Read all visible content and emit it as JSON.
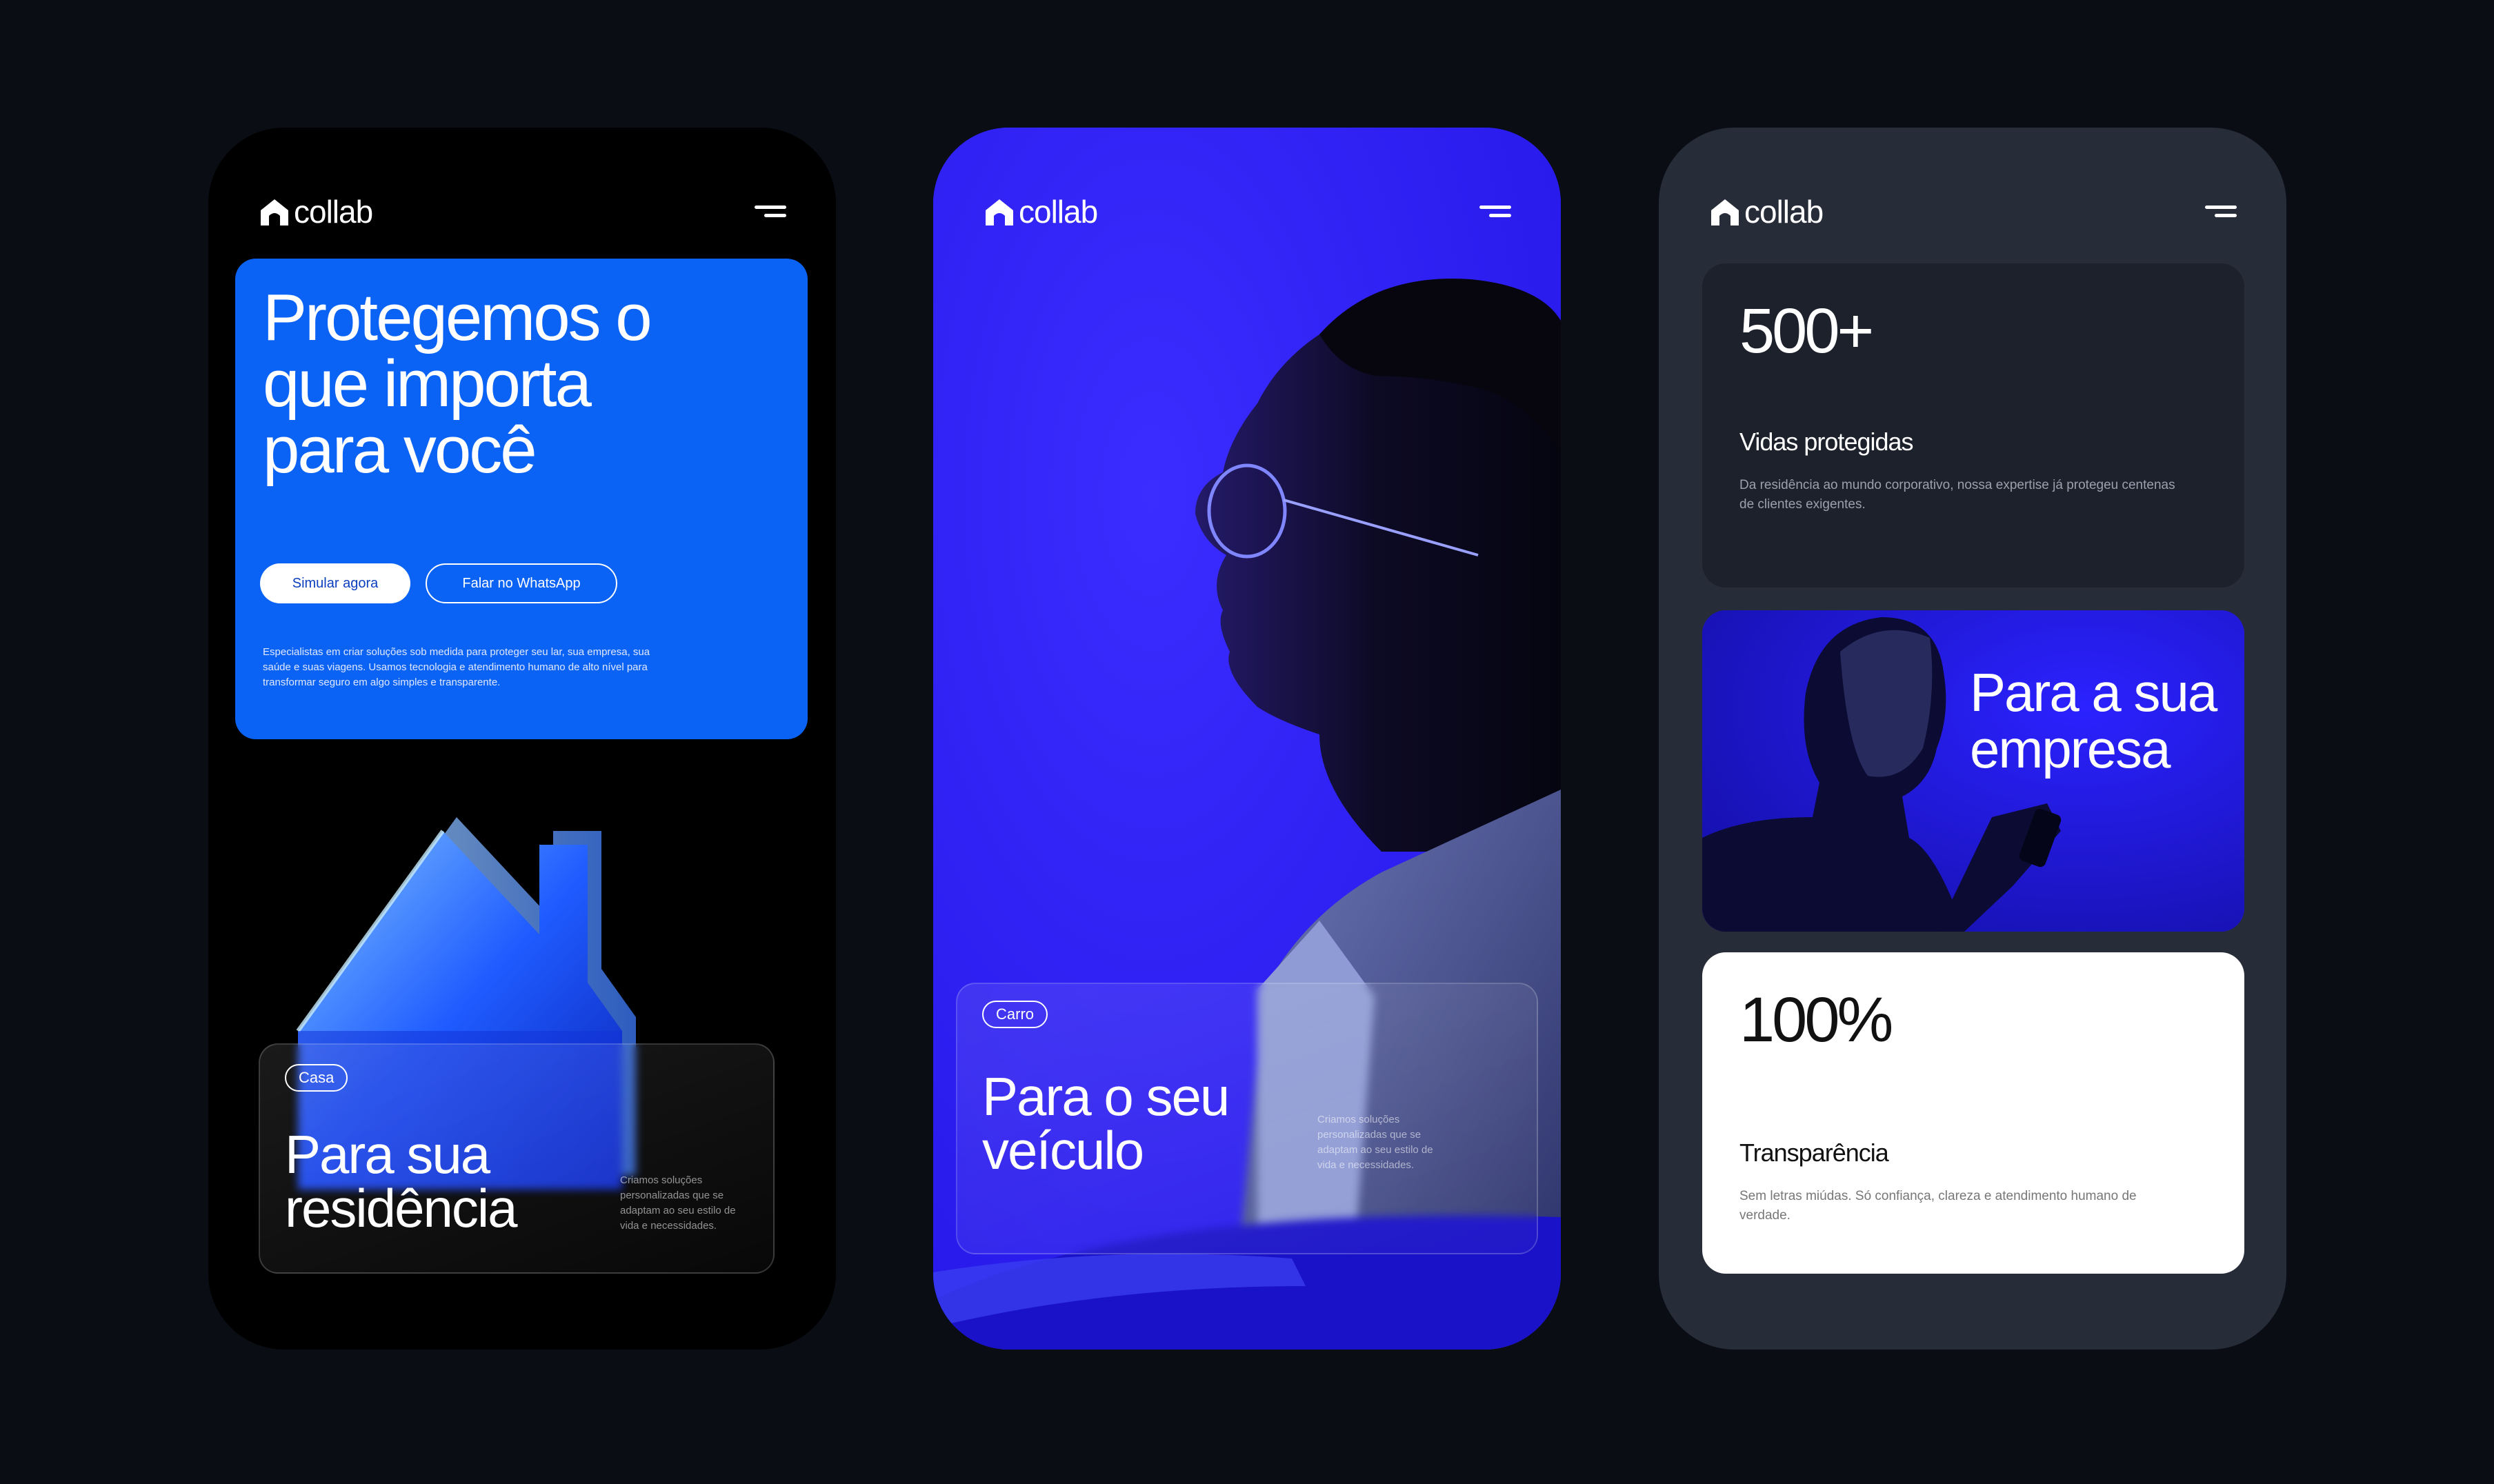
{
  "brand": {
    "logo_text": "collab"
  },
  "phone1": {
    "hero_title": "Protegemos o\nque importa\npara você",
    "primary_button": "Simular agora",
    "secondary_button": "Falar no WhatsApp",
    "hero_description": "Especialistas em criar soluções sob medida para proteger seu lar, sua empresa, sua saúde e suas viagens. Usamos tecnologia e atendimento humano de alto nível para transformar seguro em algo simples e transparente.",
    "card_tag": "Casa",
    "card_title": "Para sua\nresidência",
    "card_note": "Criamos soluções\npersonalizadas que se\nadaptam ao seu estilo de\nvida e necessidades."
  },
  "phone2": {
    "card_tag": "Carro",
    "card_title": "Para o seu\nveículo",
    "card_note": "Criamos soluções\npersonalizadas que se\nadaptam ao seu estilo de\nvida e necessidades."
  },
  "phone3": {
    "stat1_value": "500+",
    "stat1_label": "Vidas protegidas",
    "stat1_desc": "Da residência ao mundo corporativo, nossa expertise já protegeu centenas de clientes exigentes.",
    "biz_title": "Para a sua\nempresa",
    "stat2_value": "100%",
    "stat2_label": "Transparência",
    "stat2_desc": "Sem letras miúdas. Só confiança, clareza e atendimento humano de verdade."
  },
  "colors": {
    "page_background": "#0a0d14",
    "brand_blue": "#0b63f5",
    "electric_blue": "#2a1ff0",
    "slate": "#272c39"
  }
}
